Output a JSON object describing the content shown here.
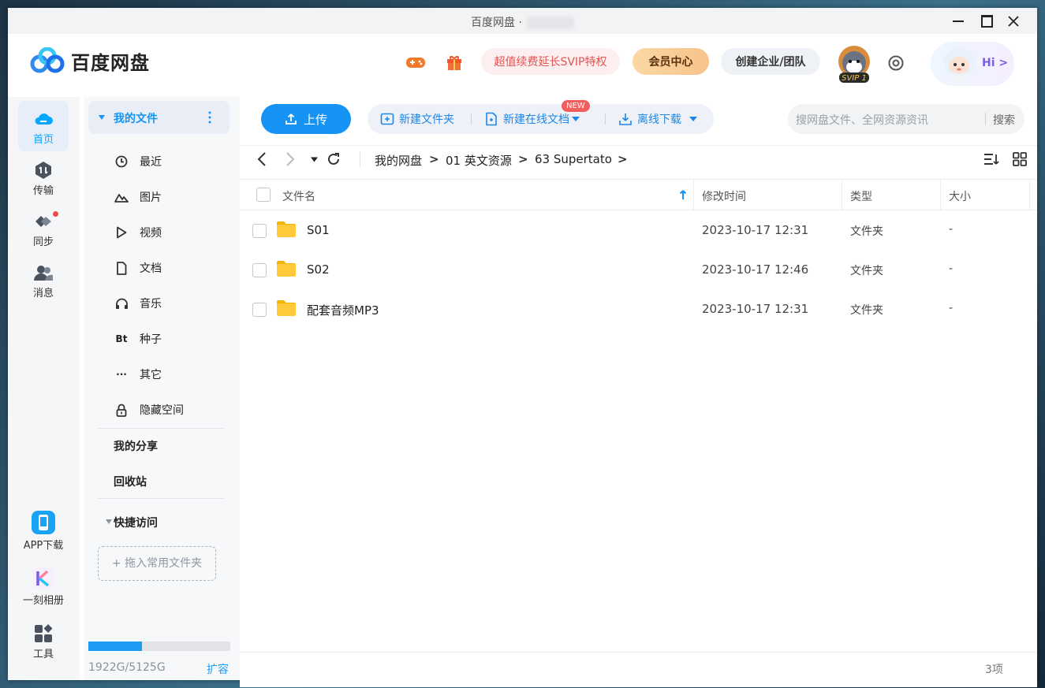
{
  "window": {
    "title": "百度网盘 ·"
  },
  "header": {
    "logo_text": "百度网盘",
    "svip_promo": "超值续费延长SVIP特权",
    "vip_center": "会员中心",
    "enterprise": "创建企业/团队",
    "vip_badge": "SVIP 1",
    "hi": "Hi >"
  },
  "leftnav": {
    "items": [
      {
        "label": "首页",
        "icon": "home-cloud-icon"
      },
      {
        "label": "传输",
        "icon": "transfer-icon"
      },
      {
        "label": "同步",
        "icon": "sync-icon"
      },
      {
        "label": "消息",
        "icon": "message-users-icon"
      },
      {
        "label": "APP下载",
        "icon": "phone-app-icon"
      },
      {
        "label": "一刻相册",
        "icon": "album-icon"
      },
      {
        "label": "工具",
        "icon": "tools-icon"
      }
    ]
  },
  "sidebar": {
    "my_files": "我的文件",
    "items": [
      {
        "label": "最近",
        "icon": "clock-icon"
      },
      {
        "label": "图片",
        "icon": "image-icon"
      },
      {
        "label": "视频",
        "icon": "play-icon"
      },
      {
        "label": "文档",
        "icon": "document-icon"
      },
      {
        "label": "音乐",
        "icon": "headphones-icon"
      },
      {
        "label": "种子",
        "icon": "torrent-bt-icon",
        "glyph": "Bt"
      },
      {
        "label": "其它",
        "icon": "more-dots-icon",
        "glyph": "···"
      },
      {
        "label": "隐藏空间",
        "icon": "lock-icon"
      }
    ],
    "my_share": "我的分享",
    "recycle": "回收站",
    "quick_access": "快捷访问",
    "drag_hint": "+ 拖入常用文件夹",
    "storage_text": "1922G/5125G",
    "storage_used_fraction": 0.375,
    "expand": "扩容"
  },
  "toolbar": {
    "upload": "上传",
    "new_folder": "新建文件夹",
    "new_doc": "新建在线文档",
    "new_badge": "NEW",
    "offline_download": "离线下载",
    "search_placeholder": "搜网盘文件、全网资源资讯",
    "search_button": "搜索"
  },
  "breadcrumb": [
    "我的网盘",
    "01 英文资源",
    "63 Supertato"
  ],
  "table": {
    "headers": {
      "name": "文件名",
      "modified": "修改时间",
      "type": "类型",
      "size": "大小"
    },
    "rows": [
      {
        "name": "S01",
        "modified": "2023-10-17 12:31",
        "type": "文件夹",
        "size": "-"
      },
      {
        "name": "S02",
        "modified": "2023-10-17 12:46",
        "type": "文件夹",
        "size": "-"
      },
      {
        "name": "配套音频MP3",
        "modified": "2023-10-17 12:31",
        "type": "文件夹",
        "size": "-"
      }
    ]
  },
  "footer": {
    "count": "3项"
  },
  "colors": {
    "accent": "#1694f5",
    "active_nav": "#06a7ff",
    "folder": "#ffc93c",
    "promo_red": "#e2524f"
  }
}
